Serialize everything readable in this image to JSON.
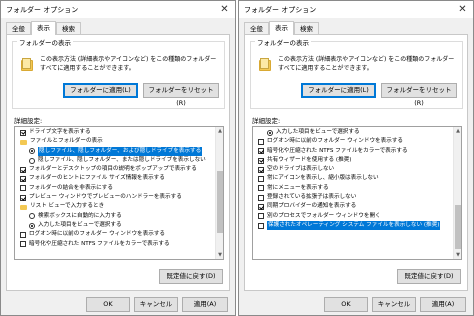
{
  "windows": [
    {
      "title": "フォルダー オプション",
      "tabs": [
        "全般",
        "表示",
        "検索"
      ],
      "active_tab": 1,
      "folder_views": {
        "label": "フォルダーの表示",
        "description": "この表示方法 (詳細表示やアイコンなど) をこの種類のフォルダーすべてに適用することができます。",
        "apply_button": "フォルダーに適用(L)",
        "reset_button": "フォルダーをリセット(R)"
      },
      "advanced_label": "詳細設定:",
      "scroll_thumb_fraction": 0.47,
      "items": [
        {
          "type": "checkbox",
          "checked": true,
          "indent": 0,
          "label": "ドライブ文字を表示する"
        },
        {
          "type": "folder",
          "checked": false,
          "indent": 0,
          "label": "ファイルとフォルダーの表示"
        },
        {
          "type": "radio",
          "checked": true,
          "indent": 1,
          "selected": true,
          "label": "隠しファイル、隠しフォルダー、および隠しドライブを表示する"
        },
        {
          "type": "radio",
          "checked": false,
          "indent": 1,
          "label": "隠しファイル、隠しフォルダー、または隠しドライブを表示しない"
        },
        {
          "type": "checkbox",
          "checked": true,
          "indent": 0,
          "label": "フォルダーとデスクトップの項目の説明をポップアップで表示する"
        },
        {
          "type": "checkbox",
          "checked": true,
          "indent": 0,
          "label": "フォルダーのヒントにファイル サイズ情報を表示する"
        },
        {
          "type": "checkbox",
          "checked": false,
          "indent": 0,
          "label": "フォルダーの結合を非表示にする"
        },
        {
          "type": "checkbox",
          "checked": true,
          "indent": 0,
          "label": "プレビュー ウィンドウでプレビューのハンドラーを表示する"
        },
        {
          "type": "folder",
          "checked": false,
          "indent": 0,
          "label": "リスト ビューで入力するとき"
        },
        {
          "type": "radio",
          "checked": false,
          "indent": 1,
          "label": "検索ボックスに自動的に入力する"
        },
        {
          "type": "radio",
          "checked": true,
          "indent": 1,
          "label": "入力した項目をビューで選択する"
        },
        {
          "type": "checkbox",
          "checked": false,
          "indent": 0,
          "label": "ログオン時に以前のフォルダー ウィンドウを表示する"
        },
        {
          "type": "checkbox",
          "checked": false,
          "indent": 0,
          "label": "暗号化や圧縮された NTFS ファイルをカラーで表示する"
        }
      ],
      "restore_button": "既定値に戻す(D)",
      "ok_button": "OK",
      "cancel_button": "キャンセル",
      "apply_button": "適用(A)"
    },
    {
      "title": "フォルダー オプション",
      "tabs": [
        "全般",
        "表示",
        "検索"
      ],
      "active_tab": 1,
      "folder_views": {
        "label": "フォルダーの表示",
        "description": "この表示方法 (詳細表示やアイコンなど) をこの種類のフォルダーすべてに適用することができます。",
        "apply_button": "フォルダーに適用(L)",
        "reset_button": "フォルダーをリセット(R)"
      },
      "advanced_label": "詳細設定:",
      "scroll_thumb_fraction": 0.34,
      "items": [
        {
          "type": "radio",
          "checked": true,
          "indent": 1,
          "label": "入力した項目をビューで選択する"
        },
        {
          "type": "checkbox",
          "checked": false,
          "indent": 0,
          "label": "ログオン時に以前のフォルダー ウィンドウを表示する"
        },
        {
          "type": "checkbox",
          "checked": true,
          "indent": 0,
          "label": "暗号化や圧縮された NTFS ファイルをカラーで表示する"
        },
        {
          "type": "checkbox",
          "checked": true,
          "indent": 0,
          "label": "共有ウィザードを使用する (推奨)"
        },
        {
          "type": "checkbox",
          "checked": true,
          "indent": 0,
          "label": "空のドライブは表示しない"
        },
        {
          "type": "checkbox",
          "checked": false,
          "indent": 0,
          "label": "常にアイコンを表示し、縮小版は表示しない"
        },
        {
          "type": "checkbox",
          "checked": false,
          "indent": 0,
          "label": "常にメニューを表示する"
        },
        {
          "type": "checkbox",
          "checked": false,
          "indent": 0,
          "label": "登録されている拡張子は表示しない"
        },
        {
          "type": "checkbox",
          "checked": true,
          "indent": 0,
          "label": "同期プロバイダーの通知を表示する"
        },
        {
          "type": "checkbox",
          "checked": false,
          "indent": 0,
          "label": "別のプロセスでフォルダー ウィンドウを開く"
        },
        {
          "type": "checkbox",
          "checked": false,
          "indent": 0,
          "selected": true,
          "label": "保護されたオペレーティング システム ファイルを表示しない (推奨)"
        }
      ],
      "restore_button": "既定値に戻す(D)",
      "ok_button": "OK",
      "cancel_button": "キャンセル",
      "apply_button": "適用(A)"
    }
  ],
  "icons": {
    "close": "close-icon",
    "folder_view": "folder-icon",
    "scroll_up": "chevron-up-icon",
    "scroll_down": "chevron-down-icon"
  },
  "colors": {
    "selection": "#0078d7",
    "window_bg": "#f0f0f0",
    "folder": "#f3c853"
  }
}
